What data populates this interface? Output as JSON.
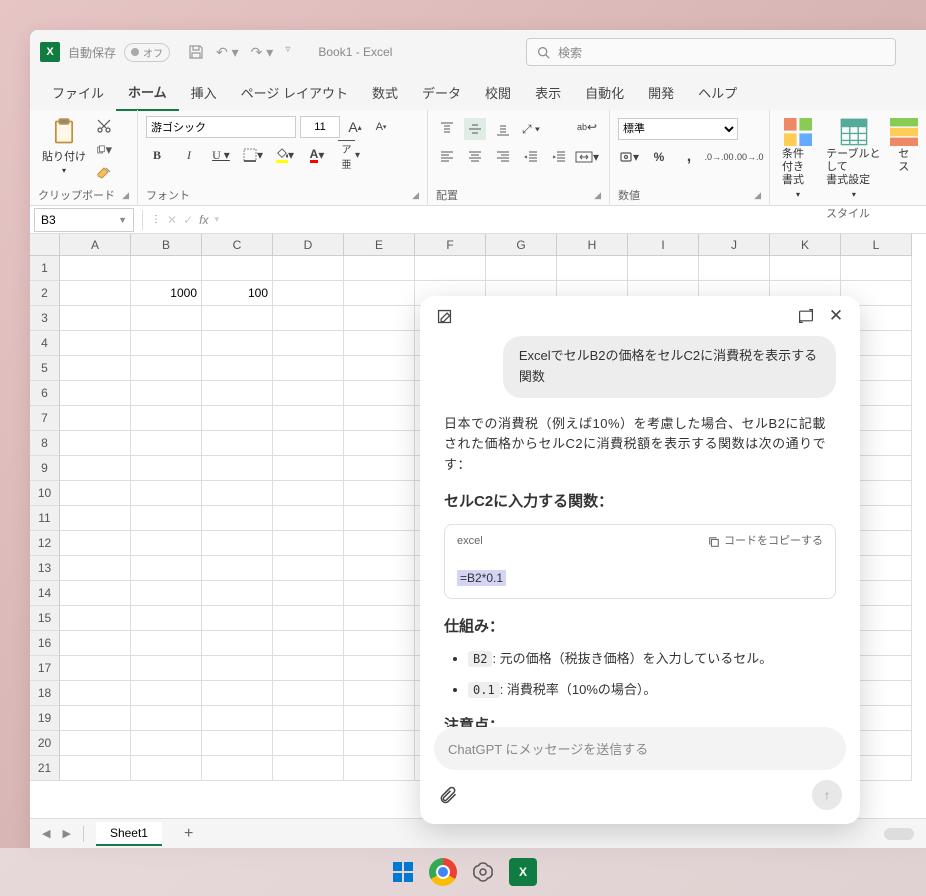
{
  "titlebar": {
    "autosave_label": "自動保存",
    "autosave_state": "オフ",
    "doc_title": "Book1 - Excel",
    "search_placeholder": "検索"
  },
  "tabs": {
    "items": [
      "ファイル",
      "ホーム",
      "挿入",
      "ページ レイアウト",
      "数式",
      "データ",
      "校閲",
      "表示",
      "自動化",
      "開発",
      "ヘルプ"
    ],
    "active_index": 1
  },
  "ribbon": {
    "clipboard": {
      "paste": "貼り付け",
      "label": "クリップボード"
    },
    "font": {
      "name": "游ゴシック",
      "size": "11",
      "label": "フォント"
    },
    "alignment": {
      "label": "配置"
    },
    "number": {
      "format": "標準",
      "label": "数値"
    },
    "styles": {
      "cond": "条件付き\n書式",
      "table": "テーブルとして\n書式設定",
      "cell": "セ\nス",
      "label": "スタイル"
    }
  },
  "formula_bar": {
    "name_box": "B3",
    "formula": ""
  },
  "grid": {
    "columns": [
      "A",
      "B",
      "C",
      "D",
      "E",
      "F",
      "G",
      "H",
      "I",
      "J",
      "K",
      "L"
    ],
    "rows_count": 21,
    "cells": {
      "B2": "1000",
      "C2": "100"
    }
  },
  "sheet": {
    "name": "Sheet1"
  },
  "chat": {
    "user_message": "ExcelでセルB2の価格をセルC2に消費税を表示する関数",
    "response_intro": "日本での消費税（例えば10%）を考慮した場合、セルB2に記載された価格からセルC2に消費税額を表示する関数は次の通りです：",
    "heading1": "セルC2に入力する関数：",
    "code_lang": "excel",
    "copy_label": "コードをコピーする",
    "code": "=B2*0.1",
    "heading2": "仕組み：",
    "bullet1_code": "B2",
    "bullet1_text": ": 元の価格（税抜き価格）を入力しているセル。",
    "bullet2_code": "0.1",
    "bullet2_text": ": 消費税率（10%の場合）。",
    "heading3": "注意点：",
    "input_placeholder": "ChatGPT にメッセージを送信する"
  }
}
